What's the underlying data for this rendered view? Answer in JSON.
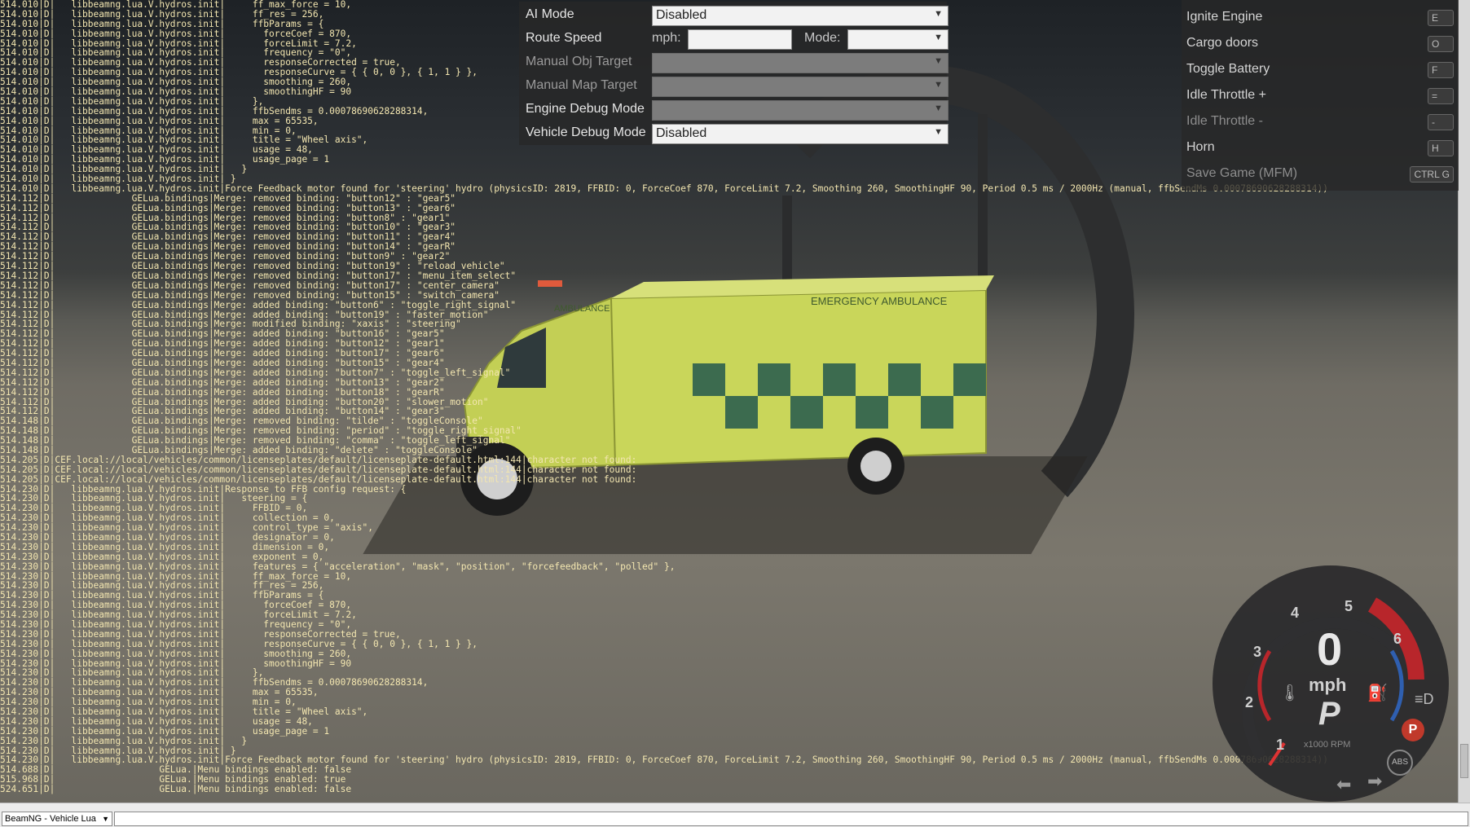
{
  "console": {
    "lines": [
      "514.010|D|   libbeamng.lua.V.hydros.init|     ff_max_force = 10,",
      "514.010|D|   libbeamng.lua.V.hydros.init|     ff_res = 256,",
      "514.010|D|   libbeamng.lua.V.hydros.init|     ffbParams = {",
      "514.010|D|   libbeamng.lua.V.hydros.init|       forceCoef = 870,",
      "514.010|D|   libbeamng.lua.V.hydros.init|       forceLimit = 7.2,",
      "514.010|D|   libbeamng.lua.V.hydros.init|       frequency = \"0\",",
      "514.010|D|   libbeamng.lua.V.hydros.init|       responseCorrected = true,",
      "514.010|D|   libbeamng.lua.V.hydros.init|       responseCurve = { { 0, 0 }, { 1, 1 } },",
      "514.010|D|   libbeamng.lua.V.hydros.init|       smoothing = 260,",
      "514.010|D|   libbeamng.lua.V.hydros.init|       smoothingHF = 90",
      "514.010|D|   libbeamng.lua.V.hydros.init|     },",
      "514.010|D|   libbeamng.lua.V.hydros.init|     ffbSendms = 0.00078690628288314,",
      "514.010|D|   libbeamng.lua.V.hydros.init|     max = 65535,",
      "514.010|D|   libbeamng.lua.V.hydros.init|     min = 0,",
      "514.010|D|   libbeamng.lua.V.hydros.init|     title = \"Wheel axis\",",
      "514.010|D|   libbeamng.lua.V.hydros.init|     usage = 48,",
      "514.010|D|   libbeamng.lua.V.hydros.init|     usage_page = 1",
      "514.010|D|   libbeamng.lua.V.hydros.init|   }",
      "514.010|D|   libbeamng.lua.V.hydros.init| }",
      "514.010|D|   libbeamng.lua.V.hydros.init|Force Feedback motor found for 'steering' hydro (physicsID: 2819, FFBID: 0, ForceCoef 870, ForceLimit 7.2, Smoothing 260, SmoothingHF 90, Period 0.5 ms / 2000Hz (manual, ffbSendMs 0.00078690628288314))",
      "514.112|D|              GELua.bindings|Merge: removed binding: \"button12\" : \"gear5\"",
      "514.112|D|              GELua.bindings|Merge: removed binding: \"button13\" : \"gear6\"",
      "514.112|D|              GELua.bindings|Merge: removed binding: \"button8\" : \"gear1\"",
      "514.112|D|              GELua.bindings|Merge: removed binding: \"button10\" : \"gear3\"",
      "514.112|D|              GELua.bindings|Merge: removed binding: \"button11\" : \"gear4\"",
      "514.112|D|              GELua.bindings|Merge: removed binding: \"button14\" : \"gearR\"",
      "514.112|D|              GELua.bindings|Merge: removed binding: \"button9\" : \"gear2\"",
      "514.112|D|              GELua.bindings|Merge: removed binding: \"button19\" : \"reload_vehicle\"",
      "514.112|D|              GELua.bindings|Merge: removed binding: \"button17\" : \"menu_item_select\"",
      "514.112|D|              GELua.bindings|Merge: removed binding: \"button17\" : \"center_camera\"",
      "514.112|D|              GELua.bindings|Merge: removed binding: \"button15\" : \"switch_camera\"",
      "514.112|D|              GELua.bindings|Merge: added binding: \"button6\" : \"toggle_right_signal\"",
      "514.112|D|              GELua.bindings|Merge: added binding: \"button19\" : \"faster_motion\"",
      "514.112|D|              GELua.bindings|Merge: modified binding: \"xaxis\" : \"steering\"",
      "514.112|D|              GELua.bindings|Merge: added binding: \"button16\" : \"gear5\"",
      "514.112|D|              GELua.bindings|Merge: added binding: \"button12\" : \"gear1\"",
      "514.112|D|              GELua.bindings|Merge: added binding: \"button17\" : \"gear6\"",
      "514.112|D|              GELua.bindings|Merge: added binding: \"button15\" : \"gear4\"",
      "514.112|D|              GELua.bindings|Merge: added binding: \"button7\" : \"toggle_left_signal\"",
      "514.112|D|              GELua.bindings|Merge: added binding: \"button13\" : \"gear2\"",
      "514.112|D|              GELua.bindings|Merge: added binding: \"button18\" : \"gearR\"",
      "514.112|D|              GELua.bindings|Merge: added binding: \"button20\" : \"slower_motion\"",
      "514.112|D|              GELua.bindings|Merge: added binding: \"button14\" : \"gear3\"",
      "514.148|D|              GELua.bindings|Merge: removed binding: \"tilde\" : \"toggleConsole\"",
      "514.148|D|              GELua.bindings|Merge: removed binding: \"period\" : \"toggle_right_signal\"",
      "514.148|D|              GELua.bindings|Merge: removed binding: \"comma\" : \"toggle_left_signal\"",
      "514.148|D|              GELua.bindings|Merge: added binding: \"delete\" : \"toggleConsole\"",
      "514.205|D|CEF.local://local/vehicles/common/licenseplates/default/licenseplate-default.html:144|character not found:",
      "514.205|D|CEF.local://local/vehicles/common/licenseplates/default/licenseplate-default.html:144|character not found:",
      "514.205|D|CEF.local://local/vehicles/common/licenseplates/default/licenseplate-default.html:144|character not found:",
      "514.230|D|   libbeamng.lua.V.hydros.init|Response to FFB config request: {",
      "514.230|D|   libbeamng.lua.V.hydros.init|   steering = {",
      "514.230|D|   libbeamng.lua.V.hydros.init|     FFBID = 0,",
      "514.230|D|   libbeamng.lua.V.hydros.init|     collection = 0,",
      "514.230|D|   libbeamng.lua.V.hydros.init|     control_type = \"axis\",",
      "514.230|D|   libbeamng.lua.V.hydros.init|     designator = 0,",
      "514.230|D|   libbeamng.lua.V.hydros.init|     dimension = 0,",
      "514.230|D|   libbeamng.lua.V.hydros.init|     exponent = 0,",
      "514.230|D|   libbeamng.lua.V.hydros.init|     features = { \"acceleration\", \"mask\", \"position\", \"forcefeedback\", \"polled\" },",
      "514.230|D|   libbeamng.lua.V.hydros.init|     ff_max_force = 10,",
      "514.230|D|   libbeamng.lua.V.hydros.init|     ff_res = 256,",
      "514.230|D|   libbeamng.lua.V.hydros.init|     ffbParams = {",
      "514.230|D|   libbeamng.lua.V.hydros.init|       forceCoef = 870,",
      "514.230|D|   libbeamng.lua.V.hydros.init|       forceLimit = 7.2,",
      "514.230|D|   libbeamng.lua.V.hydros.init|       frequency = \"0\",",
      "514.230|D|   libbeamng.lua.V.hydros.init|       responseCorrected = true,",
      "514.230|D|   libbeamng.lua.V.hydros.init|       responseCurve = { { 0, 0 }, { 1, 1 } },",
      "514.230|D|   libbeamng.lua.V.hydros.init|       smoothing = 260,",
      "514.230|D|   libbeamng.lua.V.hydros.init|       smoothingHF = 90",
      "514.230|D|   libbeamng.lua.V.hydros.init|     },",
      "514.230|D|   libbeamng.lua.V.hydros.init|     ffbSendms = 0.00078690628288314,",
      "514.230|D|   libbeamng.lua.V.hydros.init|     max = 65535,",
      "514.230|D|   libbeamng.lua.V.hydros.init|     min = 0,",
      "514.230|D|   libbeamng.lua.V.hydros.init|     title = \"Wheel axis\",",
      "514.230|D|   libbeamng.lua.V.hydros.init|     usage = 48,",
      "514.230|D|   libbeamng.lua.V.hydros.init|     usage_page = 1",
      "514.230|D|   libbeamng.lua.V.hydros.init|   }",
      "514.230|D|   libbeamng.lua.V.hydros.init| }",
      "514.230|D|   libbeamng.lua.V.hydros.init|Force Feedback motor found for 'steering' hydro (physicsID: 2819, FFBID: 0, ForceCoef 870, ForceLimit 7.2, Smoothing 260, SmoothingHF 90, Period 0.5 ms / 2000Hz (manual, ffbSendMs 0.00078690628288314))",
      "514.688|D|                   GELua.|Menu bindings enabled: false",
      "515.968|D|                   GELua.|Menu bindings enabled: true",
      "524.651|D|                   GELua.|Menu bindings enabled: false"
    ]
  },
  "ai_panel": {
    "ai_mode_label": "AI Mode",
    "ai_mode_value": "Disabled",
    "route_speed_label": "Route Speed",
    "mph_label": "mph:",
    "mode_label": "Mode:",
    "manual_obj_label": "Manual Obj Target",
    "manual_map_label": "Manual Map Target",
    "engine_debug_label": "Engine Debug Mode",
    "vehicle_debug_label": "Vehicle Debug Mode",
    "vehicle_debug_value": "Disabled"
  },
  "actions": {
    "items": [
      {
        "label": "Ignite Engine",
        "key": "E"
      },
      {
        "label": "Cargo doors",
        "key": "O"
      },
      {
        "label": "Toggle Battery",
        "key": "F"
      },
      {
        "label": "Idle Throttle +",
        "key": "="
      },
      {
        "label": "Idle Throttle -",
        "key": "-"
      },
      {
        "label": "Horn",
        "key": "H"
      },
      {
        "label": "Save Game (MFM)",
        "key": "CTRL G"
      }
    ]
  },
  "gauge": {
    "speed": "0",
    "unit": "mph",
    "gear": "P",
    "rpm_label": "x1000 RPM",
    "park_badge": "P",
    "abs_badge": "ABS",
    "ticks": [
      "1",
      "2",
      "3",
      "4",
      "5",
      "6"
    ]
  },
  "vehicle": {
    "side_text": "EMERGENCY AMBULANCE",
    "hood_text": "AMBULANCE"
  },
  "taskbar": {
    "context": "BeamNG - Vehicle Lua"
  },
  "colors": {
    "console_text": "#f3e6b0",
    "panel_bg": "#282828",
    "gauge_red": "#b8262b",
    "gauge_blue": "#2f5fb0",
    "park_badge": "#c0392b"
  }
}
